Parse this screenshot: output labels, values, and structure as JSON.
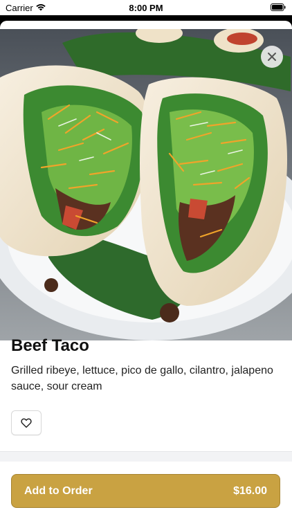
{
  "status_bar": {
    "carrier": "Carrier",
    "time": "8:00 PM",
    "wifi_icon": "wifi-icon",
    "battery_icon": "battery-icon"
  },
  "hero": {
    "image_subject": "two beef tacos with lettuce, cheese and tomato on a plate",
    "close_icon": "close-icon"
  },
  "item": {
    "title": "Beef Taco",
    "description": "Grilled ribeye, lettuce, pico de gallo, cilantro, jalapeno sauce, sour cream",
    "favorite_icon": "heart-outline-icon"
  },
  "cta": {
    "label": "Add to Order",
    "price": "$16.00"
  },
  "colors": {
    "accent": "#c9a242",
    "background": "#ffffff",
    "text": "#111111"
  }
}
